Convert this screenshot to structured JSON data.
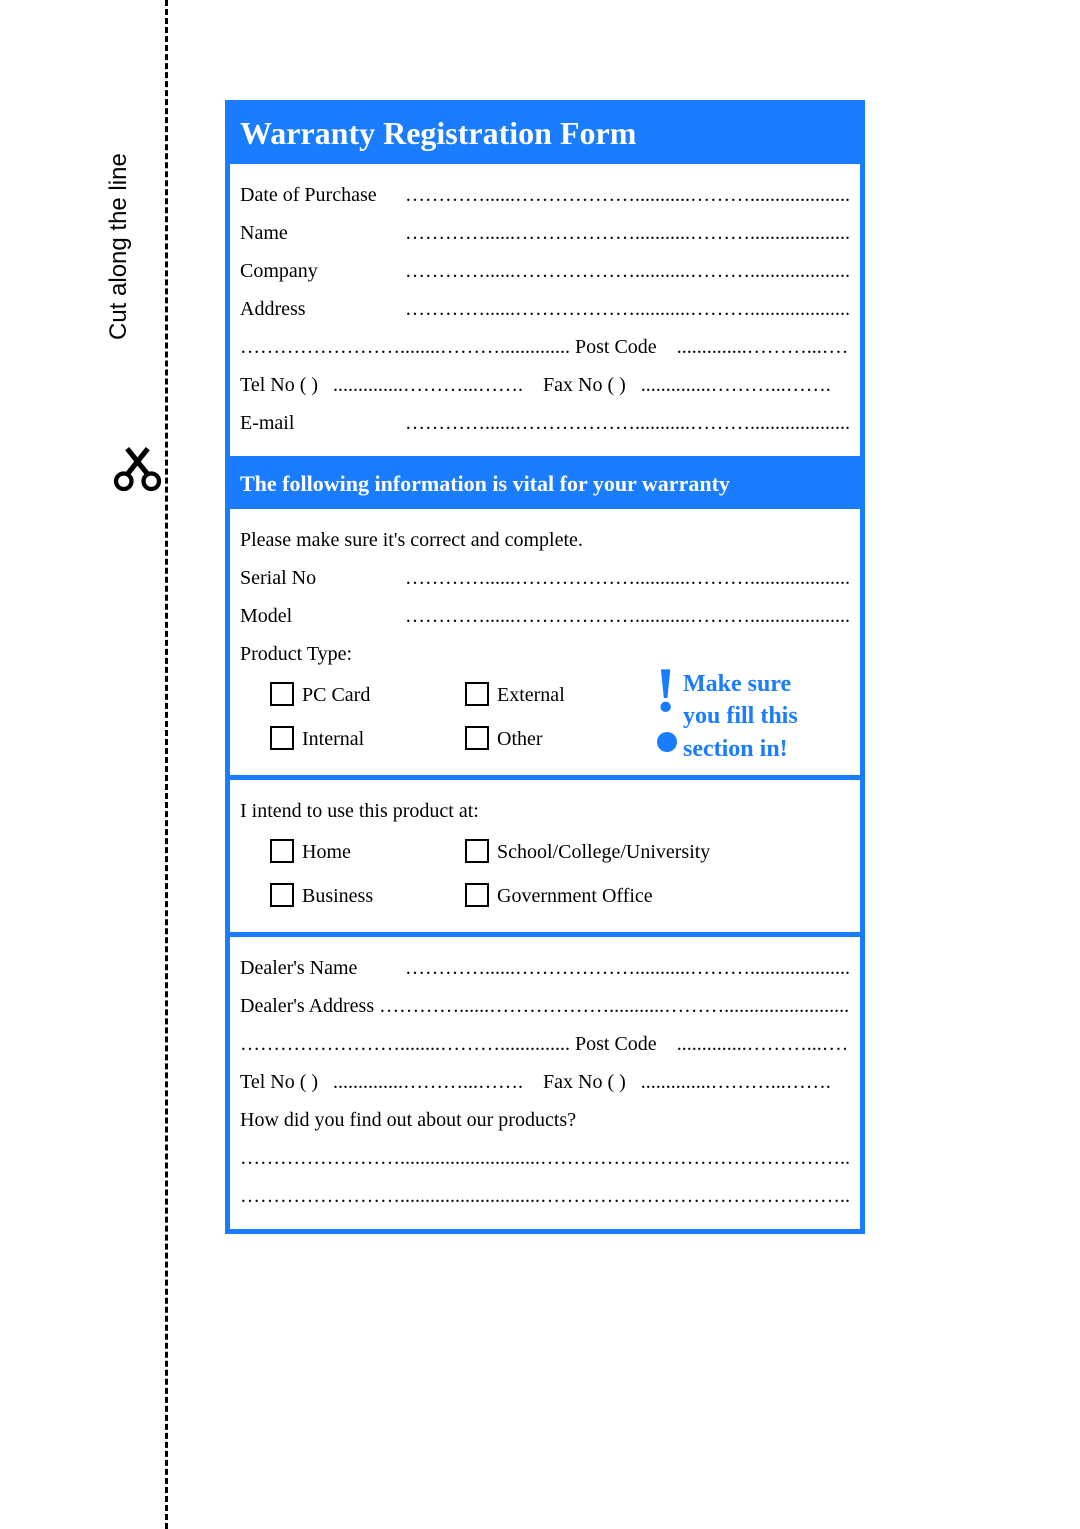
{
  "cut_label": "Cut along the line",
  "header": "Warranty Registration Form",
  "section1": {
    "date_of_purchase": "Date of Purchase",
    "name": "Name",
    "company": "Company",
    "address": "Address",
    "post_code": "Post Code",
    "tel_no": "Tel No (      )",
    "fax_no": "Fax No (     )",
    "email": "E-mail"
  },
  "subheader": "The following information is vital for your warranty",
  "section2": {
    "please": "Please make sure it's correct and complete.",
    "serial_no": "Serial No",
    "model": "Model",
    "product_type": "Product Type:",
    "opts": {
      "pc_card": "PC Card",
      "external": "External",
      "internal": "Internal",
      "other": "Other"
    },
    "callout": {
      "l1": "Make sure",
      "l2": "you fill this",
      "l3": "section in!"
    }
  },
  "section3": {
    "intend": "I intend to use this product at:",
    "opts": {
      "home": "Home",
      "school": "School/College/University",
      "business": "Business",
      "gov": "Government Office"
    }
  },
  "section4": {
    "dealer_name": "Dealer's Name",
    "dealer_address": "Dealer's Address",
    "post_code": "Post Code",
    "tel_no": "Tel No (      )",
    "fax_no": "Fax No (     )",
    "how": "How did you find out about our products?"
  },
  "dots": "…………......………………...........………................................",
  "dots_short": "..............………...…….",
  "dots_full": "……………………........………..............",
  "dots_vlong": "……………………............................………………………………………....…………"
}
